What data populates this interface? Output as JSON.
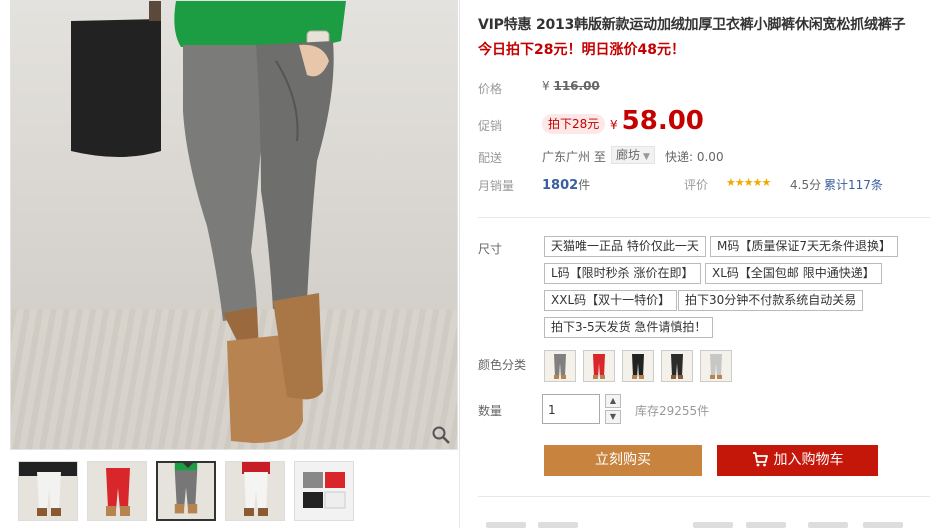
{
  "product": {
    "title": "VIP特惠 2013韩版新款运动加绒加厚卫衣裤小脚裤休闲宽松抓绒裤子",
    "promo": "今日拍下28元！明日涨价48元！"
  },
  "price": {
    "label": "价格",
    "currency": "¥",
    "original": "116.00"
  },
  "promotion": {
    "label": "促销",
    "tag": "拍下28元",
    "currency": "¥",
    "price": "58.00"
  },
  "shipping": {
    "label": "配送",
    "from": "广东广州 至",
    "to": "廊坊",
    "fee": "快递: 0.00"
  },
  "sales": {
    "label": "月销量",
    "count": "1802",
    "unit": "件"
  },
  "rating": {
    "label": "评价",
    "stars": "★★★★★",
    "score": "4.5分",
    "reviews": "累计117条"
  },
  "size": {
    "label": "尺寸",
    "options": [
      "天猫唯一正品 特价仅此一天",
      "M码【质量保证7天无条件退换】",
      "L码【限时秒杀 涨价在即】",
      "XL码【全国包邮 限中通快递】",
      "XXL码【双十一特价】",
      "拍下30分钟不付款系统自动关易",
      "拍下3-5天发货 急件请慎拍！"
    ]
  },
  "color": {
    "label": "颜色分类",
    "swatches": [
      "grey-pants",
      "red-pants",
      "black-pants",
      "black-pants-2",
      "light-grey-pants"
    ]
  },
  "quantity": {
    "label": "数量",
    "value": "1",
    "stock": "库存29255件"
  },
  "actions": {
    "buy_now": "立刻购买",
    "add_to_cart": "加入购物车"
  },
  "gallery": {
    "thumbnails": [
      "white-pants-thumb",
      "red-pants-thumb",
      "grey-pants-thumb",
      "white-pants-2-thumb",
      "folded-pants-thumb"
    ],
    "active_thumbnail": 3
  },
  "colors": {
    "accent_red": "#c40000",
    "buy_button": "#c8843f",
    "cart_button": "#c4170a",
    "star": "#f2a900"
  }
}
